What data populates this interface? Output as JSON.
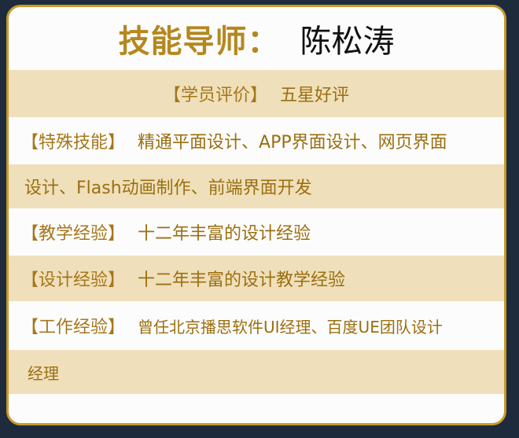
{
  "header": {
    "label": "技能导师：",
    "name": "陈松涛"
  },
  "rows": [
    {
      "label": "【学员评价】",
      "value": "五星好评"
    },
    {
      "label": "【特殊技能】",
      "value": "精通平面设计、APP界面设计、网页界面"
    },
    {
      "label": "",
      "value": "设计、Flash动画制作、前端界面开发"
    },
    {
      "label": "【教学经验】",
      "value": "十二年丰富的设计经验"
    },
    {
      "label": "【设计经验】",
      "value": "十二年丰富的设计教学经验"
    },
    {
      "label": "【工作经验】",
      "value": "曾任北京播思软件UI经理、百度UE团队设计"
    },
    {
      "label": "",
      "value": "经理"
    }
  ],
  "colors": {
    "accent_gold": "#b5881f",
    "row_tint": "#efdfba",
    "border": "#c59a2e",
    "background": "#1d2b3c"
  }
}
